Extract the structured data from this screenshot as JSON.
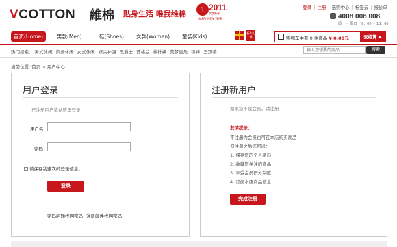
{
  "brand": {
    "logo_v": "V",
    "logo_rest": "COTTON",
    "logo_cn": "維棉",
    "slogan": "贴身生活 唯我维棉"
  },
  "year_badge": {
    "ox": "牛",
    "year": "2011",
    "sub": "欢度新春",
    "hny": "HAPPY NEW YEAR"
  },
  "toplinks": [
    {
      "label": "登录",
      "red": true
    },
    {
      "label": "注册",
      "red": true
    },
    {
      "label": "选购中心",
      "red": false
    },
    {
      "label": "标签云",
      "red": false
    },
    {
      "label": "报价单",
      "red": false
    }
  ],
  "phone": {
    "number": "4008 008 008",
    "hours": "周一 ~ 周日 ：9：00 ~ 18：00"
  },
  "nav": {
    "items": [
      "首页(Home)",
      "男款(Men)",
      "鞋(Shoes)",
      "女款(Women)",
      "童装(Kids)"
    ],
    "newyear_badge": "新年礼遇"
  },
  "cart": {
    "prefix": "购物车中有",
    "count": "0",
    "suffix": "件商品",
    "total": "¥ 0.00元",
    "checkout": "去结算 ▶"
  },
  "hot_search": {
    "label": "热门搜索：",
    "terms": [
      "男式休闲",
      "商务休闲",
      "女式休闲",
      "袜尖补强",
      "黑爵士",
      "苏格兰",
      "棉针袜",
      "美梦直角",
      "锦袢",
      "三双装"
    ]
  },
  "search": {
    "placeholder": "输入您想要的商品",
    "button": "搜索"
  },
  "breadcrumb": "当前位置: 首页 > 用户中心",
  "login": {
    "title": "用户登录",
    "hint": "已注册用户请从这里登录",
    "username_label": "用户名",
    "password_label": "密码",
    "remember": "请保存我这次的登录信息。",
    "submit": "登录",
    "link_password": "密码问题找回密码",
    "link_email": "注册邮件找回密码"
  },
  "register": {
    "title": "注册新用户",
    "hint": "如果您不是会员，请注册",
    "tip_title": "友情提示：",
    "tips": [
      "不注册为会员也可在本店购买商品",
      "但注册之后您可以：",
      "1. 保存您的个人资料",
      "2. 收藏您关注的商品",
      "3. 享受会员积分制度",
      "4. 订阅本店商品信息"
    ],
    "submit": "完成注册"
  },
  "colors": {
    "accent": "#c8161d"
  }
}
